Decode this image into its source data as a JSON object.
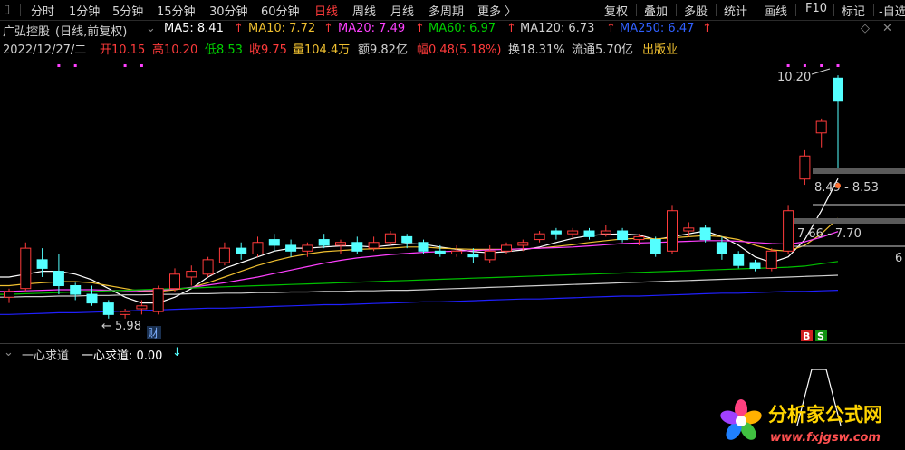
{
  "toolbar": {
    "items": [
      {
        "label": "分时"
      },
      {
        "label": "1分钟"
      },
      {
        "label": "5分钟"
      },
      {
        "label": "15分钟"
      },
      {
        "label": "30分钟"
      },
      {
        "label": "60分钟"
      },
      {
        "label": "日线",
        "active": true
      },
      {
        "label": "周线"
      },
      {
        "label": "月线"
      },
      {
        "label": "多周期"
      },
      {
        "label": "更多 〉"
      }
    ],
    "right_items": [
      {
        "label": "复权"
      },
      {
        "label": "叠加"
      },
      {
        "label": "多股"
      },
      {
        "label": "统计"
      },
      {
        "label": "画线"
      },
      {
        "label": "F10"
      },
      {
        "label": "标记"
      },
      {
        "label": "-自选"
      }
    ],
    "sidebar_icon": "bar-icon"
  },
  "header": {
    "stock_name": "广弘控股",
    "mode": "(日线,前复权)",
    "ma5": "MA5: 8.41",
    "ma10": "MA10: 7.72",
    "ma20": "MA20: 7.49",
    "ma60": "MA60: 6.97",
    "ma120": "MA120: 6.73",
    "ma250": "MA250: 6.47",
    "up_arrow": "↑",
    "date": "2022/12/27/二",
    "open": "开10.15",
    "high": "高10.20",
    "low": "低8.53",
    "close": "收9.75",
    "volume": "量104.4万",
    "amount": "额9.82亿",
    "change": "幅0.48(5.18%)",
    "turnover": "换18.31%",
    "float": "流通5.70亿",
    "industry": "出版业"
  },
  "colors": {
    "up": "#ff3b3b",
    "down": "#54ffff",
    "ma5": "#ffffff",
    "ma10": "#f0c030",
    "ma20": "#ff40ff",
    "ma60": "#00c000",
    "ma120": "#d0d0d0",
    "ma250": "#2020ff",
    "industry": "#f0c030"
  },
  "chart": {
    "price_labels": {
      "high_label": "10.20",
      "low_label": "← 5.98",
      "finance_tag": "财",
      "band1": "8.49 - 8.53",
      "band2": "7.66 - 7.70",
      "right_edge": "6"
    },
    "indicator": {
      "name": "一心求道",
      "value_text": "一心求道: 0.00",
      "arrow": "↓",
      "buy_badge": "B",
      "sell_badge": "S"
    }
  },
  "chart_data": {
    "type": "candlestick",
    "title": "广弘控股 (日线,前复权)",
    "ylim": [
      5.6,
      10.5
    ],
    "candles": [
      {
        "o": 6.35,
        "h": 6.5,
        "l": 6.25,
        "c": 6.45
      },
      {
        "o": 6.5,
        "h": 7.3,
        "l": 6.45,
        "c": 7.2
      },
      {
        "o": 7.0,
        "h": 7.2,
        "l": 6.7,
        "c": 6.85
      },
      {
        "o": 6.8,
        "h": 7.1,
        "l": 6.4,
        "c": 6.55
      },
      {
        "o": 6.55,
        "h": 6.6,
        "l": 6.3,
        "c": 6.4
      },
      {
        "o": 6.4,
        "h": 6.55,
        "l": 6.2,
        "c": 6.25
      },
      {
        "o": 6.25,
        "h": 6.3,
        "l": 5.98,
        "c": 6.05
      },
      {
        "o": 6.05,
        "h": 6.15,
        "l": 5.98,
        "c": 6.1
      },
      {
        "o": 6.15,
        "h": 6.3,
        "l": 6.05,
        "c": 6.2
      },
      {
        "o": 6.1,
        "h": 6.55,
        "l": 6.05,
        "c": 6.5
      },
      {
        "o": 6.5,
        "h": 6.85,
        "l": 6.45,
        "c": 6.75
      },
      {
        "o": 6.7,
        "h": 6.9,
        "l": 6.55,
        "c": 6.8
      },
      {
        "o": 6.75,
        "h": 7.05,
        "l": 6.7,
        "c": 7.0
      },
      {
        "o": 6.95,
        "h": 7.3,
        "l": 6.9,
        "c": 7.2
      },
      {
        "o": 7.2,
        "h": 7.3,
        "l": 7.0,
        "c": 7.1
      },
      {
        "o": 7.1,
        "h": 7.4,
        "l": 7.05,
        "c": 7.3
      },
      {
        "o": 7.35,
        "h": 7.45,
        "l": 7.15,
        "c": 7.25
      },
      {
        "o": 7.25,
        "h": 7.35,
        "l": 7.05,
        "c": 7.15
      },
      {
        "o": 7.15,
        "h": 7.3,
        "l": 7.05,
        "c": 7.25
      },
      {
        "o": 7.35,
        "h": 7.45,
        "l": 7.2,
        "c": 7.25
      },
      {
        "o": 7.25,
        "h": 7.35,
        "l": 7.1,
        "c": 7.3
      },
      {
        "o": 7.3,
        "h": 7.4,
        "l": 7.1,
        "c": 7.15
      },
      {
        "o": 7.2,
        "h": 7.4,
        "l": 7.15,
        "c": 7.3
      },
      {
        "o": 7.3,
        "h": 7.5,
        "l": 7.25,
        "c": 7.45
      },
      {
        "o": 7.4,
        "h": 7.45,
        "l": 7.2,
        "c": 7.3
      },
      {
        "o": 7.3,
        "h": 7.35,
        "l": 7.1,
        "c": 7.15
      },
      {
        "o": 7.15,
        "h": 7.25,
        "l": 7.05,
        "c": 7.1
      },
      {
        "o": 7.1,
        "h": 7.25,
        "l": 7.05,
        "c": 7.15
      },
      {
        "o": 7.1,
        "h": 7.2,
        "l": 6.95,
        "c": 7.05
      },
      {
        "o": 7.0,
        "h": 7.25,
        "l": 6.95,
        "c": 7.15
      },
      {
        "o": 7.15,
        "h": 7.3,
        "l": 7.1,
        "c": 7.25
      },
      {
        "o": 7.25,
        "h": 7.35,
        "l": 7.15,
        "c": 7.3
      },
      {
        "o": 7.35,
        "h": 7.5,
        "l": 7.3,
        "c": 7.45
      },
      {
        "o": 7.5,
        "h": 7.55,
        "l": 7.35,
        "c": 7.45
      },
      {
        "o": 7.45,
        "h": 7.55,
        "l": 7.35,
        "c": 7.5
      },
      {
        "o": 7.5,
        "h": 7.55,
        "l": 7.35,
        "c": 7.4
      },
      {
        "o": 7.45,
        "h": 7.6,
        "l": 7.4,
        "c": 7.5
      },
      {
        "o": 7.5,
        "h": 7.55,
        "l": 7.3,
        "c": 7.35
      },
      {
        "o": 7.35,
        "h": 7.45,
        "l": 7.25,
        "c": 7.4
      },
      {
        "o": 7.35,
        "h": 7.4,
        "l": 7.05,
        "c": 7.1
      },
      {
        "o": 7.15,
        "h": 7.95,
        "l": 7.1,
        "c": 7.85
      },
      {
        "o": 7.5,
        "h": 7.65,
        "l": 7.4,
        "c": 7.55
      },
      {
        "o": 7.55,
        "h": 7.6,
        "l": 7.3,
        "c": 7.35
      },
      {
        "o": 7.3,
        "h": 7.4,
        "l": 7.0,
        "c": 7.1
      },
      {
        "o": 7.1,
        "h": 7.15,
        "l": 6.85,
        "c": 6.9
      },
      {
        "o": 6.95,
        "h": 7.0,
        "l": 6.8,
        "c": 6.85
      },
      {
        "o": 6.85,
        "h": 7.2,
        "l": 6.8,
        "c": 7.15
      },
      {
        "o": 7.15,
        "h": 7.95,
        "l": 7.1,
        "c": 7.85
      },
      {
        "o": 8.4,
        "h": 8.9,
        "l": 8.3,
        "c": 8.8
      },
      {
        "o": 9.2,
        "h": 9.45,
        "l": 8.95,
        "c": 9.4
      },
      {
        "o": 10.15,
        "h": 10.2,
        "l": 8.53,
        "c": 9.75
      }
    ],
    "series": [
      {
        "name": "MA5",
        "values": [
          6.7,
          6.75,
          6.8,
          6.8,
          6.75,
          6.65,
          6.5,
          6.35,
          6.25,
          6.25,
          6.35,
          6.5,
          6.7,
          6.85,
          6.95,
          7.05,
          7.15,
          7.2,
          7.2,
          7.22,
          7.24,
          7.24,
          7.22,
          7.25,
          7.28,
          7.27,
          7.22,
          7.18,
          7.14,
          7.12,
          7.14,
          7.17,
          7.22,
          7.3,
          7.37,
          7.42,
          7.44,
          7.45,
          7.43,
          7.35,
          7.4,
          7.45,
          7.5,
          7.4,
          7.25,
          7.05,
          6.95,
          7.05,
          7.35,
          7.85,
          8.41
        ]
      },
      {
        "name": "MA10",
        "values": [
          6.55,
          6.58,
          6.6,
          6.62,
          6.62,
          6.6,
          6.55,
          6.5,
          6.45,
          6.45,
          6.48,
          6.52,
          6.6,
          6.7,
          6.8,
          6.9,
          6.98,
          7.05,
          7.1,
          7.14,
          7.16,
          7.18,
          7.19,
          7.2,
          7.22,
          7.22,
          7.2,
          7.19,
          7.18,
          7.18,
          7.18,
          7.19,
          7.2,
          7.23,
          7.26,
          7.3,
          7.33,
          7.36,
          7.37,
          7.36,
          7.38,
          7.4,
          7.42,
          7.4,
          7.35,
          7.25,
          7.17,
          7.15,
          7.25,
          7.45,
          7.72
        ]
      },
      {
        "name": "MA20",
        "values": [
          6.45,
          6.46,
          6.47,
          6.48,
          6.48,
          6.48,
          6.47,
          6.46,
          6.46,
          6.47,
          6.49,
          6.52,
          6.56,
          6.6,
          6.65,
          6.7,
          6.76,
          6.82,
          6.88,
          6.94,
          6.99,
          7.03,
          7.06,
          7.09,
          7.11,
          7.13,
          7.14,
          7.15,
          7.16,
          7.17,
          7.18,
          7.19,
          7.2,
          7.21,
          7.22,
          7.24,
          7.26,
          7.28,
          7.29,
          7.3,
          7.31,
          7.32,
          7.33,
          7.33,
          7.32,
          7.3,
          7.28,
          7.27,
          7.31,
          7.39,
          7.49
        ]
      },
      {
        "name": "MA60",
        "values": [
          6.4,
          6.41,
          6.42,
          6.43,
          6.44,
          6.45,
          6.46,
          6.47,
          6.48,
          6.49,
          6.5,
          6.51,
          6.52,
          6.53,
          6.54,
          6.55,
          6.56,
          6.57,
          6.58,
          6.59,
          6.6,
          6.61,
          6.62,
          6.63,
          6.64,
          6.65,
          6.66,
          6.67,
          6.68,
          6.69,
          6.7,
          6.71,
          6.72,
          6.73,
          6.74,
          6.75,
          6.76,
          6.77,
          6.78,
          6.79,
          6.8,
          6.81,
          6.82,
          6.83,
          6.84,
          6.85,
          6.86,
          6.87,
          6.89,
          6.93,
          6.97
        ]
      },
      {
        "name": "MA120",
        "values": [
          6.35,
          6.36,
          6.36,
          6.37,
          6.37,
          6.38,
          6.38,
          6.39,
          6.39,
          6.4,
          6.4,
          6.41,
          6.41,
          6.42,
          6.42,
          6.43,
          6.43,
          6.44,
          6.44,
          6.45,
          6.45,
          6.46,
          6.46,
          6.47,
          6.47,
          6.48,
          6.49,
          6.5,
          6.51,
          6.52,
          6.53,
          6.54,
          6.55,
          6.56,
          6.57,
          6.58,
          6.59,
          6.6,
          6.61,
          6.62,
          6.63,
          6.64,
          6.65,
          6.66,
          6.67,
          6.68,
          6.69,
          6.7,
          6.71,
          6.72,
          6.73
        ]
      },
      {
        "name": "MA250",
        "values": [
          6.05,
          6.06,
          6.07,
          6.08,
          6.08,
          6.09,
          6.1,
          6.11,
          6.12,
          6.13,
          6.14,
          6.15,
          6.16,
          6.16,
          6.17,
          6.18,
          6.19,
          6.2,
          6.21,
          6.22,
          6.22,
          6.23,
          6.24,
          6.25,
          6.26,
          6.27,
          6.27,
          6.28,
          6.29,
          6.3,
          6.31,
          6.32,
          6.32,
          6.33,
          6.34,
          6.35,
          6.36,
          6.37,
          6.37,
          6.38,
          6.39,
          6.4,
          6.41,
          6.42,
          6.42,
          6.43,
          6.44,
          6.45,
          6.45,
          6.46,
          6.47
        ]
      }
    ]
  },
  "logo": {
    "name": "分析家公式网",
    "url_text": "www.fxjgsw.com"
  }
}
